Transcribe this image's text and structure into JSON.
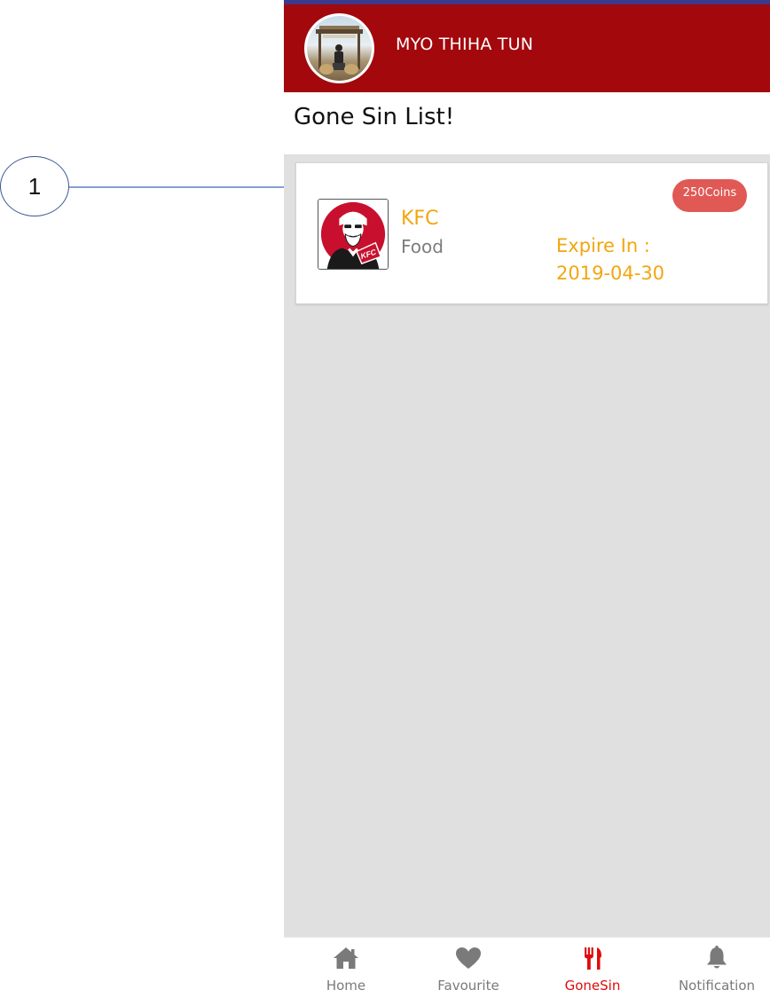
{
  "annotation": {
    "marker_label": "1"
  },
  "header": {
    "username": "MYO THIHA TUN",
    "avatar_icon": "user-avatar-photo",
    "strip_color": "#3d3a8c",
    "background_color": "#a3080c"
  },
  "page": {
    "title": "Gone Sin List!"
  },
  "offers": [
    {
      "brand": "KFC",
      "category": "Food",
      "expire_label": "Expire In :",
      "expire_date": "2019-04-30",
      "coins": "250Coins",
      "logo_icon": "kfc-logo",
      "logo_text": "KFC"
    }
  ],
  "colors": {
    "accent_orange": "#f2a60f",
    "badge_red": "#e05955",
    "active_nav": "#e00b0b",
    "inactive_nav": "#7a7a7a",
    "content_bg": "#e0e0e0"
  },
  "bottom_nav": {
    "items": [
      {
        "label": "Home",
        "icon": "home-icon",
        "active": false
      },
      {
        "label": "Favourite",
        "icon": "heart-icon",
        "active": false
      },
      {
        "label": "GoneSin",
        "icon": "fork-knife-icon",
        "active": true
      },
      {
        "label": "Notification",
        "icon": "bell-icon",
        "active": false
      }
    ]
  }
}
